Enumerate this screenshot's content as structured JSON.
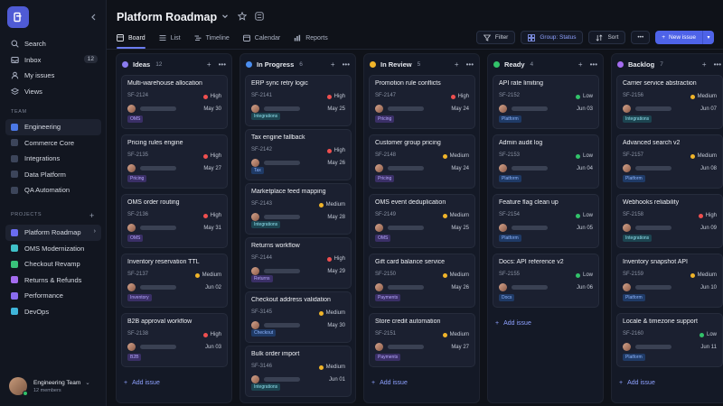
{
  "sidebar": {
    "nav": [
      {
        "label": "Search",
        "icon": "search-icon"
      },
      {
        "label": "Inbox",
        "icon": "inbox-icon",
        "badge": "12"
      },
      {
        "label": "My issues",
        "icon": "user-icon"
      },
      {
        "label": "Views",
        "icon": "layers-icon"
      }
    ],
    "team_label": "TEAM",
    "teams": [
      {
        "label": "Engineering",
        "active": true
      },
      {
        "label": "Commerce Core"
      },
      {
        "label": "Integrations"
      },
      {
        "label": "Data Platform"
      },
      {
        "label": "QA Automation"
      }
    ],
    "projects_label": "PROJECTS",
    "projects": [
      {
        "label": "Platform Roadmap",
        "color": "#6b6cf0",
        "active": true
      },
      {
        "label": "OMS Modernization",
        "color": "#3fc1c9"
      },
      {
        "label": "Checkout Revamp",
        "color": "#39c27a"
      },
      {
        "label": "Returns & Refunds",
        "color": "#a46cf0"
      },
      {
        "label": "Performance",
        "color": "#8a6cf0"
      },
      {
        "label": "DevOps",
        "color": "#3fb5d9"
      }
    ],
    "user": {
      "name": "Engineering Team",
      "members": "12 members"
    }
  },
  "header": {
    "title": "Platform Roadmap",
    "tabs": [
      {
        "label": "Board",
        "icon": "board-icon",
        "active": true
      },
      {
        "label": "List",
        "icon": "list-icon"
      },
      {
        "label": "Timeline",
        "icon": "timeline-icon"
      },
      {
        "label": "Calendar",
        "icon": "calendar-icon"
      },
      {
        "label": "Reports",
        "icon": "reports-icon"
      }
    ],
    "toolbar": {
      "filter": "Filter",
      "group": "Group: Status",
      "sort": "Sort",
      "new_issue": "New issue"
    }
  },
  "colors": {
    "high": "#ef4f4f",
    "medium": "#f0b429",
    "low": "#32c26a"
  },
  "columns": [
    {
      "name": "Ideas",
      "count": "12",
      "color": "#8a7cf0",
      "cards": [
        {
          "title": "Multi-warehouse allocation",
          "id": "SF-2124",
          "priority": "High",
          "due": "May 30",
          "tag": "OMS",
          "tagStyle": "purple"
        },
        {
          "title": "Pricing rules engine",
          "id": "SF-2135",
          "priority": "High",
          "due": "May 27",
          "tag": "Pricing",
          "tagStyle": "purple"
        },
        {
          "title": "OMS order routing",
          "id": "SF-2136",
          "priority": "High",
          "due": "May 31",
          "tag": "OMS",
          "tagStyle": "purple"
        },
        {
          "title": "Inventory reservation TTL",
          "id": "SF-2137",
          "priority": "Medium",
          "due": "Jun 02",
          "tag": "Inventory",
          "tagStyle": "purple"
        },
        {
          "title": "B2B approval workflow",
          "id": "SF-2138",
          "priority": "High",
          "due": "Jun 03",
          "tag": "B2B",
          "tagStyle": "purple"
        }
      ],
      "add_label": "Add issue"
    },
    {
      "name": "In Progress",
      "count": "6",
      "color": "#4b8ef0",
      "cards": [
        {
          "title": "ERP sync retry logic",
          "id": "SF-2141",
          "priority": "High",
          "due": "May 25",
          "tag": "Integrations",
          "tagStyle": "cyan"
        },
        {
          "title": "Tax engine fallback",
          "id": "SF-2142",
          "priority": "High",
          "due": "May 26",
          "tag": "Tax",
          "tagStyle": "blue"
        },
        {
          "title": "Marketplace feed mapping",
          "id": "SF-2143",
          "priority": "Medium",
          "due": "May 28",
          "tag": "Integrations",
          "tagStyle": "cyan"
        },
        {
          "title": "Returns workflow",
          "id": "SF-2144",
          "priority": "High",
          "due": "May 29",
          "tag": "Returns",
          "tagStyle": "purple"
        },
        {
          "title": "Checkout address validation",
          "id": "SF-3145",
          "priority": "Medium",
          "due": "May 30",
          "tag": "Checkout",
          "tagStyle": "blue"
        },
        {
          "title": "Bulk order import",
          "id": "SF-3146",
          "priority": "Medium",
          "due": "Jun 01",
          "tag": "Integrations",
          "tagStyle": "cyan"
        }
      ],
      "add_label": "Add issue"
    },
    {
      "name": "In Review",
      "count": "5",
      "color": "#f0b429",
      "cards": [
        {
          "title": "Promotion rule conflicts",
          "id": "SF-2147",
          "priority": "High",
          "due": "May 24",
          "tag": "Pricing",
          "tagStyle": "purple"
        },
        {
          "title": "Customer group pricing",
          "id": "SF-2148",
          "priority": "Medium",
          "due": "May 24",
          "tag": "Pricing",
          "tagStyle": "purple"
        },
        {
          "title": "OMS event deduplication",
          "id": "SF-2149",
          "priority": "Medium",
          "due": "May 25",
          "tag": "OMS",
          "tagStyle": "purple"
        },
        {
          "title": "Gift card balance service",
          "id": "SF-2150",
          "priority": "Medium",
          "due": "May 26",
          "tag": "Payments",
          "tagStyle": "purple"
        },
        {
          "title": "Store credit automation",
          "id": "SF-2151",
          "priority": "Medium",
          "due": "May 27",
          "tag": "Payments",
          "tagStyle": "purple"
        }
      ],
      "add_label": "Add issue"
    },
    {
      "name": "Ready",
      "count": "4",
      "color": "#32c26a",
      "cards": [
        {
          "title": "API rate limiting",
          "id": "SF-2152",
          "priority": "Low",
          "due": "Jun 03",
          "tag": "Platform",
          "tagStyle": "blue"
        },
        {
          "title": "Admin audit log",
          "id": "SF-2153",
          "priority": "Low",
          "due": "Jun 04",
          "tag": "Platform",
          "tagStyle": "blue"
        },
        {
          "title": "Feature flag clean up",
          "id": "SF-2154",
          "priority": "Low",
          "due": "Jun 05",
          "tag": "Platform",
          "tagStyle": "blue"
        },
        {
          "title": "Docs: API reference v2",
          "id": "SF-2155",
          "priority": "Low",
          "due": "Jun 06",
          "tag": "Docs",
          "tagStyle": "blue"
        }
      ],
      "add_label": "Add issue"
    },
    {
      "name": "Backlog",
      "count": "7",
      "color": "#a46cf0",
      "cards": [
        {
          "title": "Carrier service abstraction",
          "id": "SF-2156",
          "priority": "Medium",
          "due": "Jun 07",
          "tag": "Integrations",
          "tagStyle": "cyan"
        },
        {
          "title": "Advanced search v2",
          "id": "SF-2157",
          "priority": "Medium",
          "due": "Jun 08",
          "tag": "Platform",
          "tagStyle": "blue"
        },
        {
          "title": "Webhooks reliability",
          "id": "SF-2158",
          "priority": "High",
          "due": "Jun 09",
          "tag": "Integrations",
          "tagStyle": "cyan"
        },
        {
          "title": "Inventory snapshot API",
          "id": "SF-2159",
          "priority": "Medium",
          "due": "Jun 10",
          "tag": "Platform",
          "tagStyle": "blue"
        },
        {
          "title": "Locale & timezone support",
          "id": "SF-2160",
          "priority": "Low",
          "due": "Jun 11",
          "tag": "Platform",
          "tagStyle": "blue"
        }
      ],
      "add_label": "Add issue"
    }
  ]
}
